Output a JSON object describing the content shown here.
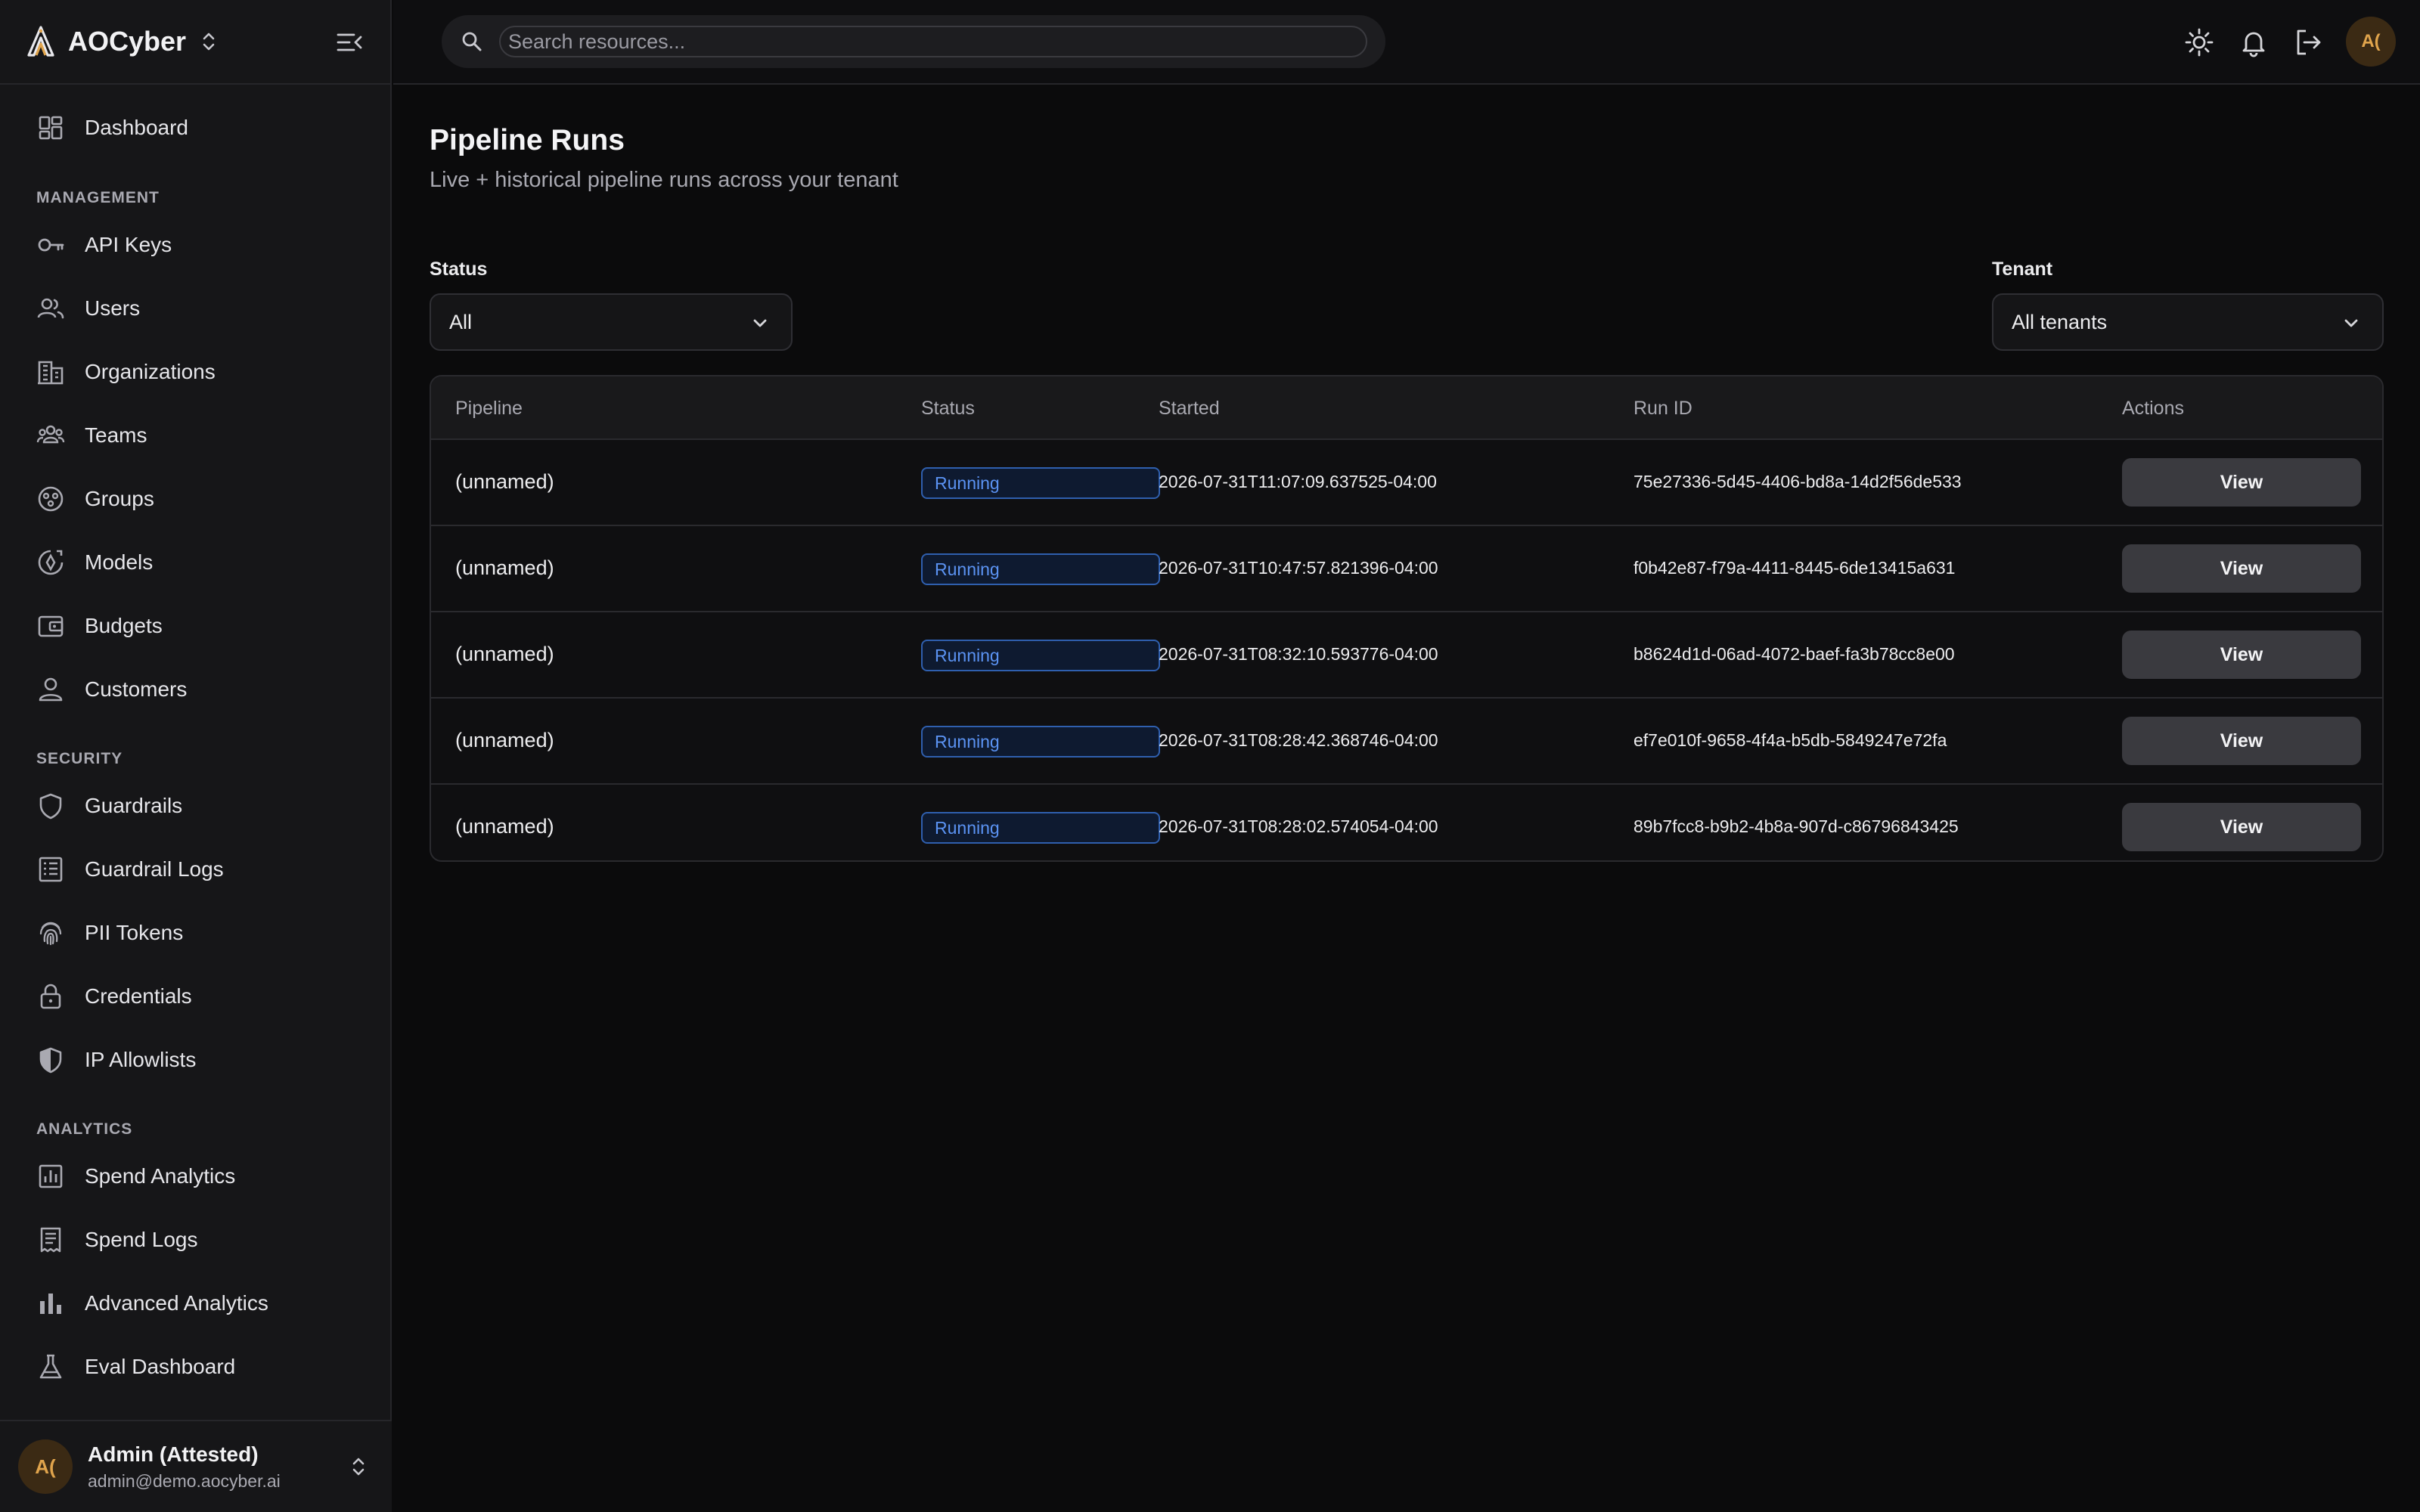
{
  "app": {
    "brand_name": "AOCyber",
    "accent_color": "#e0a44c"
  },
  "topbar": {
    "search_placeholder": "Search resources...",
    "avatar_initials": "A(",
    "icons": [
      "sun-icon",
      "bell-icon",
      "logout-icon"
    ]
  },
  "sidebar": {
    "dashboard": "Dashboard",
    "sections": [
      {
        "title": "MANAGEMENT",
        "items": [
          {
            "label": "API Keys",
            "icon": "key-icon"
          },
          {
            "label": "Users",
            "icon": "users-icon"
          },
          {
            "label": "Organizations",
            "icon": "building-icon"
          },
          {
            "label": "Teams",
            "icon": "team-icon"
          },
          {
            "label": "Groups",
            "icon": "groups-icon"
          },
          {
            "label": "Models",
            "icon": "model-icon"
          },
          {
            "label": "Budgets",
            "icon": "wallet-icon"
          },
          {
            "label": "Customers",
            "icon": "customer-icon"
          }
        ]
      },
      {
        "title": "SECURITY",
        "items": [
          {
            "label": "Guardrails",
            "icon": "shield-icon"
          },
          {
            "label": "Guardrail Logs",
            "icon": "log-icon"
          },
          {
            "label": "PII Tokens",
            "icon": "fingerprint-icon"
          },
          {
            "label": "Credentials",
            "icon": "lock-icon"
          },
          {
            "label": "IP Allowlists",
            "icon": "shield-half-icon"
          }
        ]
      },
      {
        "title": "ANALYTICS",
        "items": [
          {
            "label": "Spend Analytics",
            "icon": "chart-box-icon"
          },
          {
            "label": "Spend Logs",
            "icon": "receipt-icon"
          },
          {
            "label": "Advanced Analytics",
            "icon": "bar-chart-icon"
          },
          {
            "label": "Eval Dashboard",
            "icon": "flask-icon"
          }
        ]
      }
    ],
    "user": {
      "initials": "A(",
      "name": "Admin (Attested)",
      "email": "admin@demo.aocyber.ai"
    }
  },
  "main": {
    "title": "Pipeline Runs",
    "subtitle": "Live + historical pipeline runs across your tenant",
    "filters": {
      "status_label": "Status",
      "status_value": "All",
      "tenant_label": "Tenant",
      "tenant_value": "All tenants"
    },
    "table": {
      "headers": [
        "Pipeline",
        "Status",
        "Started",
        "Run ID",
        "Actions"
      ],
      "rows": [
        {
          "pipeline": "(unnamed)",
          "status": "Running",
          "started": "2026-07-31T11:07:09.637525-04:00",
          "run_id": "75e27336-5d45-4406-bd8a-14d2f56de533",
          "action": "View"
        },
        {
          "pipeline": "(unnamed)",
          "status": "Running",
          "started": "2026-07-31T10:47:57.821396-04:00",
          "run_id": "f0b42e87-f79a-4411-8445-6de13415a631",
          "action": "View"
        },
        {
          "pipeline": "(unnamed)",
          "status": "Running",
          "started": "2026-07-31T08:32:10.593776-04:00",
          "run_id": "b8624d1d-06ad-4072-baef-fa3b78cc8e00",
          "action": "View"
        },
        {
          "pipeline": "(unnamed)",
          "status": "Running",
          "started": "2026-07-31T08:28:42.368746-04:00",
          "run_id": "ef7e010f-9658-4f4a-b5db-5849247e72fa",
          "action": "View"
        },
        {
          "pipeline": "(unnamed)",
          "status": "Running",
          "started": "2026-07-31T08:28:02.574054-04:00",
          "run_id": "89b7fcc8-b9b2-4b8a-907d-c86796843425",
          "action": "View"
        }
      ]
    }
  }
}
